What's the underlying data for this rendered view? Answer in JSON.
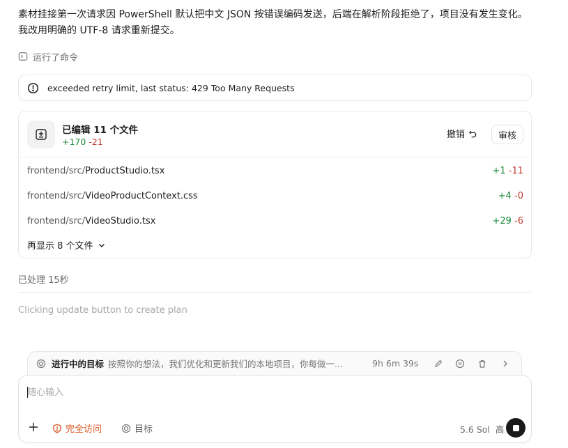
{
  "message": "素材挂接第一次请求因 PowerShell 默认把中文 JSON 按错误编码发送，后端在解析阶段拒绝了，项目没有发生变化。我改用明确的 UTF-8 请求重新提交。",
  "ran_command_label": "运行了命令",
  "error": {
    "text": "exceeded retry limit, last status: 429 Too Many Requests"
  },
  "changes": {
    "title": "已编辑 11 个文件",
    "added": "+170",
    "removed": "-21",
    "undo_label": "撤销",
    "review_label": "审核",
    "files": [
      {
        "dir": "frontend/src/",
        "name": "ProductStudio.tsx",
        "added": "+1",
        "removed": "-11"
      },
      {
        "dir": "frontend/src/",
        "name": "VideoProductContext.css",
        "added": "+4",
        "removed": "-0"
      },
      {
        "dir": "frontend/src/",
        "name": "VideoStudio.tsx",
        "added": "+29",
        "removed": "-6"
      }
    ],
    "show_more_label": "再显示 8 个文件"
  },
  "processed_label": "已处理 15秒",
  "plan_hint": "Clicking update button to create plan",
  "goal": {
    "label": "进行中的目标",
    "description": "按照你的想法，我们优化和更新我们的本地项目，你每做一...",
    "elapsed": "9h 6m 39s"
  },
  "composer": {
    "placeholder": "随心输入",
    "access_label": "完全访问",
    "target_label": "目标",
    "model_label": "5.6 Sol",
    "effort_label": "高"
  },
  "colors": {
    "added": "#1a8a3a",
    "removed": "#c0392b",
    "access": "#d9531e"
  }
}
